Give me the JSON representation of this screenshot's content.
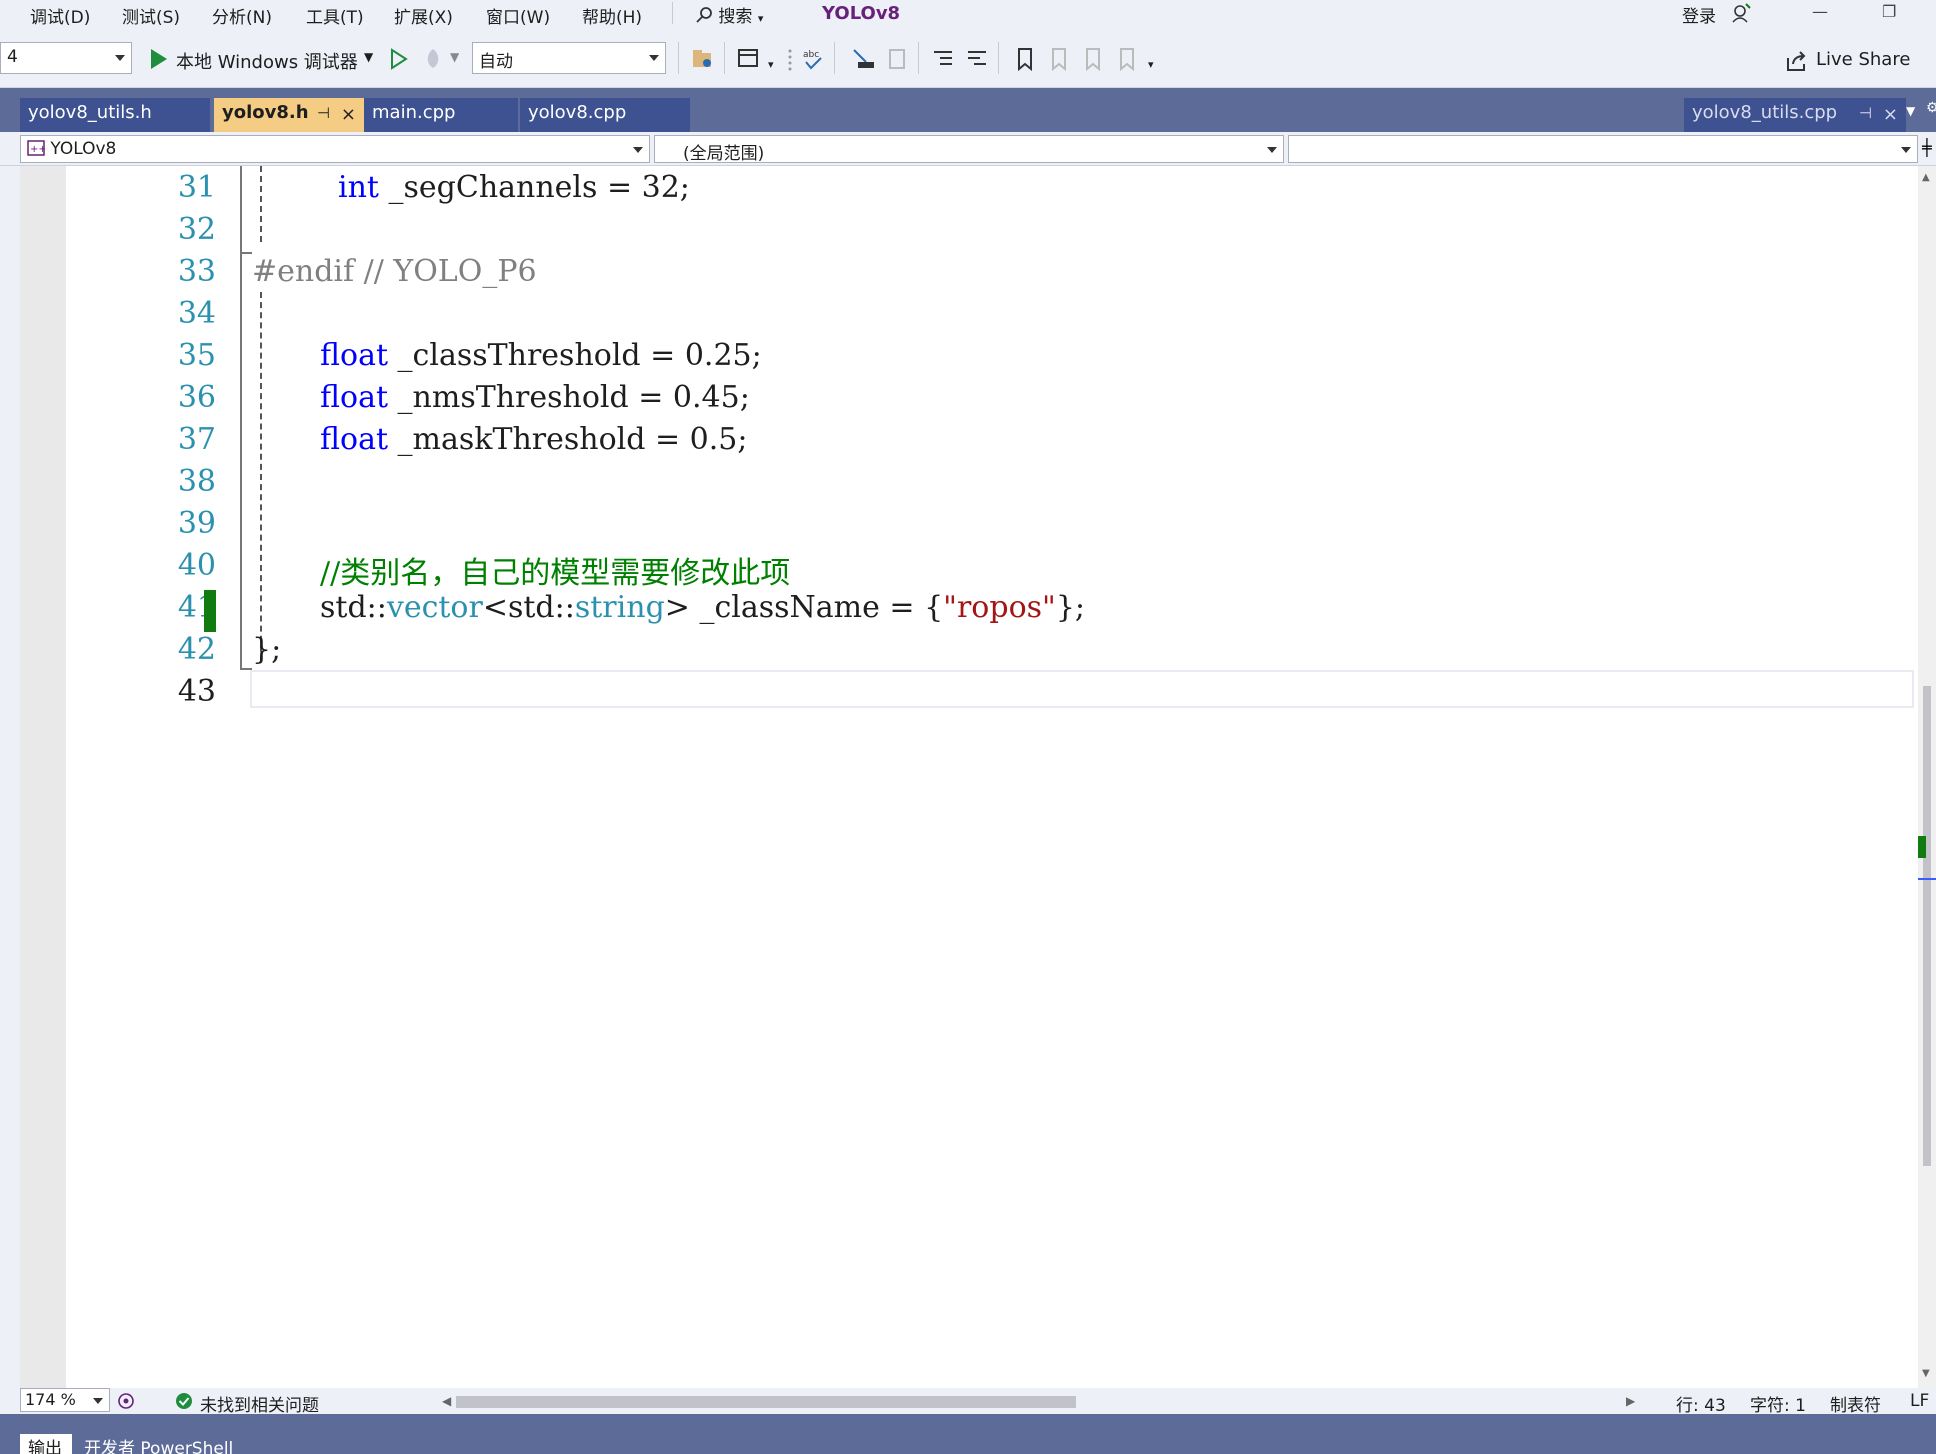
{
  "menu": {
    "items": [
      "调试(D)",
      "测试(S)",
      "分析(N)",
      "工具(T)",
      "扩展(X)",
      "窗口(W)",
      "帮助(H)"
    ],
    "search_label": "搜索",
    "app_title": "YOLOv8",
    "signin_label": "登录"
  },
  "toolbar": {
    "platform_value": "4",
    "debugger_label": "本地 Windows 调试器",
    "config_value": "自动",
    "live_share_label": "Live Share"
  },
  "tabs": {
    "left": [
      {
        "label": "yolov8_utils.h",
        "state": "inactive"
      },
      {
        "label": "yolov8.h",
        "state": "active"
      },
      {
        "label": "main.cpp",
        "state": "inactive"
      },
      {
        "label": "yolov8.cpp",
        "state": "inactive"
      }
    ],
    "right": {
      "label": "yolov8_utils.cpp"
    },
    "close_glyph": "×",
    "pin_glyph": "⊣"
  },
  "navbar": {
    "project": "YOLOv8",
    "scope": "(全局范围)",
    "member": ""
  },
  "editor": {
    "line_numbers": [
      "31",
      "32",
      "33",
      "34",
      "35",
      "36",
      "37",
      "38",
      "39",
      "40",
      "41",
      "42",
      "43"
    ],
    "current_line": "43",
    "l31": {
      "kw": "int",
      "rest": " _segChannels = 32;"
    },
    "l33": {
      "pp": "#endif",
      "cm": " // YOLO_P6"
    },
    "l35": {
      "kw": "float",
      "rest": " _classThreshold = 0.25;"
    },
    "l36": {
      "kw": "float",
      "rest": " _nmsThreshold = 0.45;"
    },
    "l37": {
      "kw": "float",
      "rest": " _maskThreshold = 0.5;"
    },
    "l40": {
      "cm": "//类别名，自己的模型需要修改此项"
    },
    "l41": {
      "p1": "std::",
      "t1": "vector",
      "p2": "<std::",
      "t2": "string",
      "p3": "> _className = {",
      "str": "\"ropos\"",
      "p4": "};"
    },
    "l42": {
      "text": "};"
    }
  },
  "status": {
    "zoom": "174 %",
    "issues": "未找到相关问题",
    "line": "行: 43",
    "char": "字符: 1",
    "tabs": "制表符",
    "eol": "LF"
  },
  "bottom_tabs": [
    "输出",
    "开发者 PowerShell"
  ],
  "colors": {
    "keyword": "#0000ff",
    "type": "#2b91af",
    "comment": "#008000",
    "string": "#a31515",
    "tab_active": "#f5cc84",
    "tab_well": "#5d6b99",
    "change_bar": "#107c10"
  }
}
